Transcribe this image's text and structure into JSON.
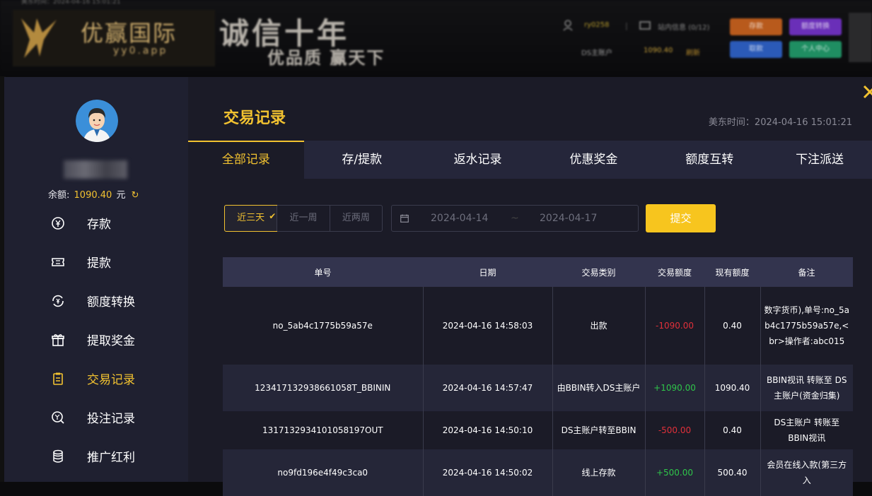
{
  "background": {
    "topbar_text": "美东时间：2024-04-16 15:01:21",
    "logo_title": "优赢国际",
    "logo_sub": "yy0.app",
    "slogan_main": "诚信十年",
    "slogan_sub": "优品质 赢天下",
    "username": "ry0258",
    "message_label": "站内信息",
    "message_count": "(0/12)",
    "account_label": "DS主账户",
    "account_value": "1090.40",
    "refresh_label": "刷新",
    "buttons": [
      "存款",
      "额度转换",
      "取款",
      "个人中心"
    ]
  },
  "sidebar": {
    "balance_label": "余额:",
    "balance_value": "1090.40",
    "balance_unit": "元",
    "refresh_glyph": "↻",
    "menu": [
      {
        "label": "存款",
        "icon": "yen-coin-icon"
      },
      {
        "label": "提款",
        "icon": "ticket-icon"
      },
      {
        "label": "额度转换",
        "icon": "exchange-icon"
      },
      {
        "label": "提取奖金",
        "icon": "gift-icon"
      },
      {
        "label": "交易记录",
        "icon": "clipboard-icon",
        "active": true
      },
      {
        "label": "投注记录",
        "icon": "bet-record-icon"
      },
      {
        "label": "推广红利",
        "icon": "coin-stack-icon"
      }
    ]
  },
  "content": {
    "title": "交易记录",
    "time_label": "美东时间：2024-04-16 15:01:21",
    "tabs": [
      "全部记录",
      "存/提款",
      "返水记录",
      "优惠奖金",
      "额度互转",
      "下注派送"
    ],
    "active_tab": 0,
    "periods": [
      "近三天",
      "近一周",
      "近两周"
    ],
    "active_period": 0,
    "period_check": "✔",
    "date_from": "2024-04-14",
    "date_sep": "~",
    "date_to": "2024-04-17",
    "submit_label": "提交"
  },
  "table": {
    "headers": [
      "单号",
      "日期",
      "交易类别",
      "交易额度",
      "现有额度",
      "备注"
    ],
    "rows": [
      {
        "id": "no_5ab4c1775b59a57e",
        "date": "2024-04-16 14:58:03",
        "type": "出款",
        "amount": "-1090.00",
        "balance": "0.40",
        "note": "数字货币),单号:no_5ab4c1775b59a57e,<br>操作者:abc015"
      },
      {
        "id": "12341713293866105​8T_BBININ",
        "date": "2024-04-16 14:57:47",
        "type": "由BBIN转入DS主账户",
        "amount": "+1090.00",
        "balance": "1090.40",
        "note": "BBIN视讯 转账至 DS主账户(资金归集)"
      },
      {
        "id": "1317132934101058197OUT",
        "date": "2024-04-16 14:50:10",
        "type": "DS主账户转至BBIN",
        "amount": "-500.00",
        "balance": "0.40",
        "note": "DS主账户 转账至 BBIN视讯"
      },
      {
        "id": "no9fd196e4f49c3ca0",
        "date": "2024-04-16 14:50:02",
        "type": "线上存款",
        "amount": "+500.00",
        "balance": "500.40",
        "note": "会员在线入款(第三方入"
      }
    ]
  },
  "colors": {
    "accent": "#f2c230",
    "negative": "#e0303a",
    "positive": "#2fc54a",
    "header_row": "#33344e",
    "sidebar_bg": "#1f2030",
    "content_bg": "#1b1b27"
  }
}
